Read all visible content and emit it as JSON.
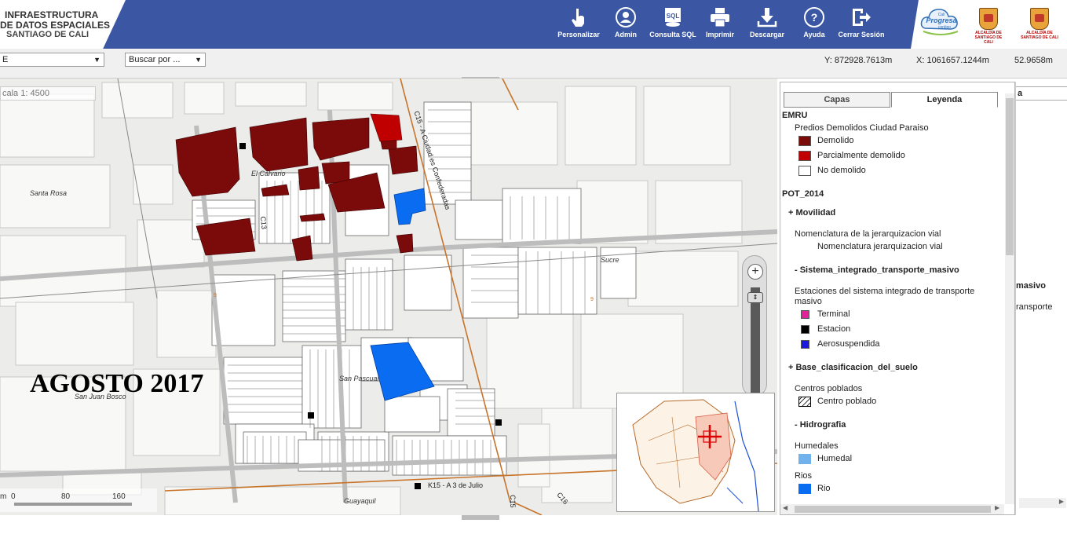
{
  "header": {
    "logo_lines": [
      "INFRAESTRUCTURA",
      "DE DATOS ESPACIALES",
      "SANTIAGO DE CALI"
    ],
    "tools": [
      {
        "label": "Personalizar",
        "icon": "hand-pointer-icon"
      },
      {
        "label": "Admin",
        "icon": "user-icon"
      },
      {
        "label": "Consulta SQL",
        "icon": "sql-database-icon"
      },
      {
        "label": "Imprimir",
        "icon": "printer-icon"
      },
      {
        "label": "Descargar",
        "icon": "download-icon"
      },
      {
        "label": "Ayuda",
        "icon": "help-icon"
      },
      {
        "label": "Cerrar Sesión",
        "icon": "logout-icon"
      }
    ],
    "brand": {
      "cali_progresa": [
        "Cali",
        "Progresa",
        "contigo"
      ],
      "alcaldia": [
        "ALCALDÍA DE",
        "SANTIAGO DE CALI"
      ]
    },
    "bg_color": "#3b57a4"
  },
  "toolbar": {
    "layer_select_value": "E",
    "search_select_value": "Buscar por ...",
    "coord_y": "Y: 872928.7613m",
    "coord_x": "X: 1061657.1244m",
    "coord_extra": "52.9658m"
  },
  "map": {
    "scale_text": "cala 1: 4500",
    "watermark": "AGOSTO 2017",
    "places": [
      "Santa Rosa",
      "El Calvario",
      "Sucre",
      "San Pascual",
      "San Juan Bosco",
      "Guayaquil"
    ],
    "streets": [
      "C15 - A Ciudad es Confederadas",
      "C13",
      "K15 - A 3 de Julio",
      "C15",
      "C16"
    ],
    "scalebar_labels": [
      "m",
      "0",
      "80",
      "160"
    ],
    "colors": {
      "demolido": "#7b0a0a",
      "parcial": "#c00000",
      "blue": "#0a6cf0",
      "street": "#c8742a"
    }
  },
  "panel": {
    "tab_capas": "Capas",
    "tab_leyenda": "Leyenda",
    "legend": {
      "emru": "EMRU",
      "predios_title": "Predios Demolidos Ciudad Paraiso",
      "demolido": "Demolido",
      "parcial": "Parcialmente demolido",
      "no_demolido": "No demolido",
      "pot": "POT_2014",
      "movilidad": "+ Movilidad",
      "nomen_title": "Nomenclatura de la jerarquizacion vial",
      "nomen_item": "Nomenclatura jerarquizacion vial",
      "sitm": "- Sistema_integrado_transporte_masivo",
      "estaciones_line1": "Estaciones del sistema integrado de transporte",
      "estaciones_line2": "masivo",
      "terminal": "Terminal",
      "estacion": "Estacion",
      "aerosuspendida": "Aerosuspendida",
      "base": "+ Base_clasificacion_del_suelo",
      "centros_title": "Centros poblados",
      "centro": "Centro poblado",
      "hidro": "- Hidrografia",
      "humedales_title": "Humedales",
      "humedal": "Humedal",
      "rios_title": "Rios",
      "rio": "Rio"
    },
    "swatch_colors": {
      "demolido": "#7b0a0a",
      "parcial": "#c00000",
      "no_demolido": "#ffffff",
      "terminal": "#e0219a",
      "estacion": "#000000",
      "aerosuspendida": "#1a1adf",
      "humedal": "#72b2ec",
      "rio": "#0a6cf0"
    }
  },
  "far_right": {
    "frag_a": "a",
    "frag_masivo": "masivo",
    "frag_transporte": "ransporte"
  }
}
